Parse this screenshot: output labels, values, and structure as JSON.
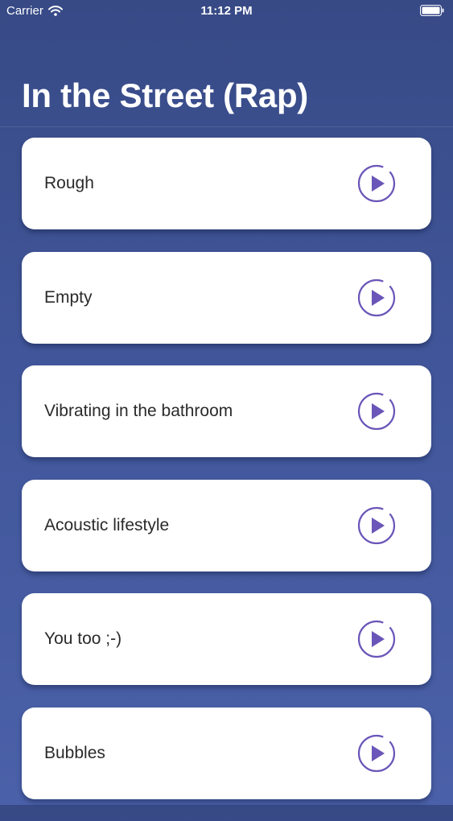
{
  "status_bar": {
    "carrier": "Carrier",
    "time": "11:12 PM",
    "icons": [
      "wifi-icon",
      "battery-icon"
    ]
  },
  "header": {
    "title": "In the Street (Rap)"
  },
  "tracks": [
    {
      "label": "Rough",
      "icon": "play-icon"
    },
    {
      "label": "Empty",
      "icon": "play-icon"
    },
    {
      "label": "Vibrating in the bathroom",
      "icon": "play-icon"
    },
    {
      "label": "Acoustic lifestyle",
      "icon": "play-icon"
    },
    {
      "label": "You too ;-)",
      "icon": "play-icon"
    },
    {
      "label": "Bubbles",
      "icon": "play-icon"
    }
  ],
  "colors": {
    "background_top": "#374a86",
    "background_bottom": "#4a60a8",
    "card": "#ffffff",
    "accent": "#6a55b8",
    "text": "#2a2a2a"
  }
}
